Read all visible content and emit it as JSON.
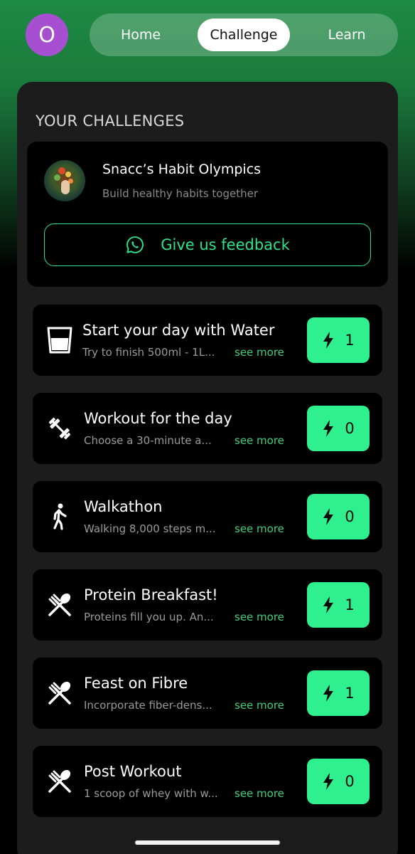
{
  "profile": {
    "initial": "O"
  },
  "nav": {
    "home": "Home",
    "challenge": "Challenge",
    "learn": "Learn"
  },
  "section_title": "YOUR CHALLENGES",
  "group": {
    "name": "Snacc’s Habit Olympics",
    "subtitle": "Build healthy habits together",
    "feedback_label": "Give us feedback"
  },
  "see_more_label": "see more",
  "habits": [
    {
      "title": "Start your day with Water",
      "desc": "Try to finish 500ml - 1L...",
      "count": "1",
      "icon": "water-glass-icon"
    },
    {
      "title": "Workout for the day",
      "desc": "Choose a 30-minute a...",
      "count": "0",
      "icon": "dumbbell-icon"
    },
    {
      "title": "Walkathon",
      "desc": "Walking 8,000 steps m...",
      "count": "0",
      "icon": "walking-icon"
    },
    {
      "title": "Protein Breakfast!",
      "desc": "Proteins fill you up. An...",
      "count": "1",
      "icon": "fork-spoon-icon"
    },
    {
      "title": "Feast on Fibre",
      "desc": "Incorporate fiber-dens...",
      "count": "1",
      "icon": "fork-spoon-icon"
    },
    {
      "title": "Post Workout",
      "desc": "1 scoop of whey with w...",
      "count": "0",
      "icon": "fork-spoon-icon"
    }
  ],
  "colors": {
    "accent": "#2ef08e",
    "avatar": "#a64fd0",
    "card": "#000000",
    "panel": "#1c1c1c"
  }
}
